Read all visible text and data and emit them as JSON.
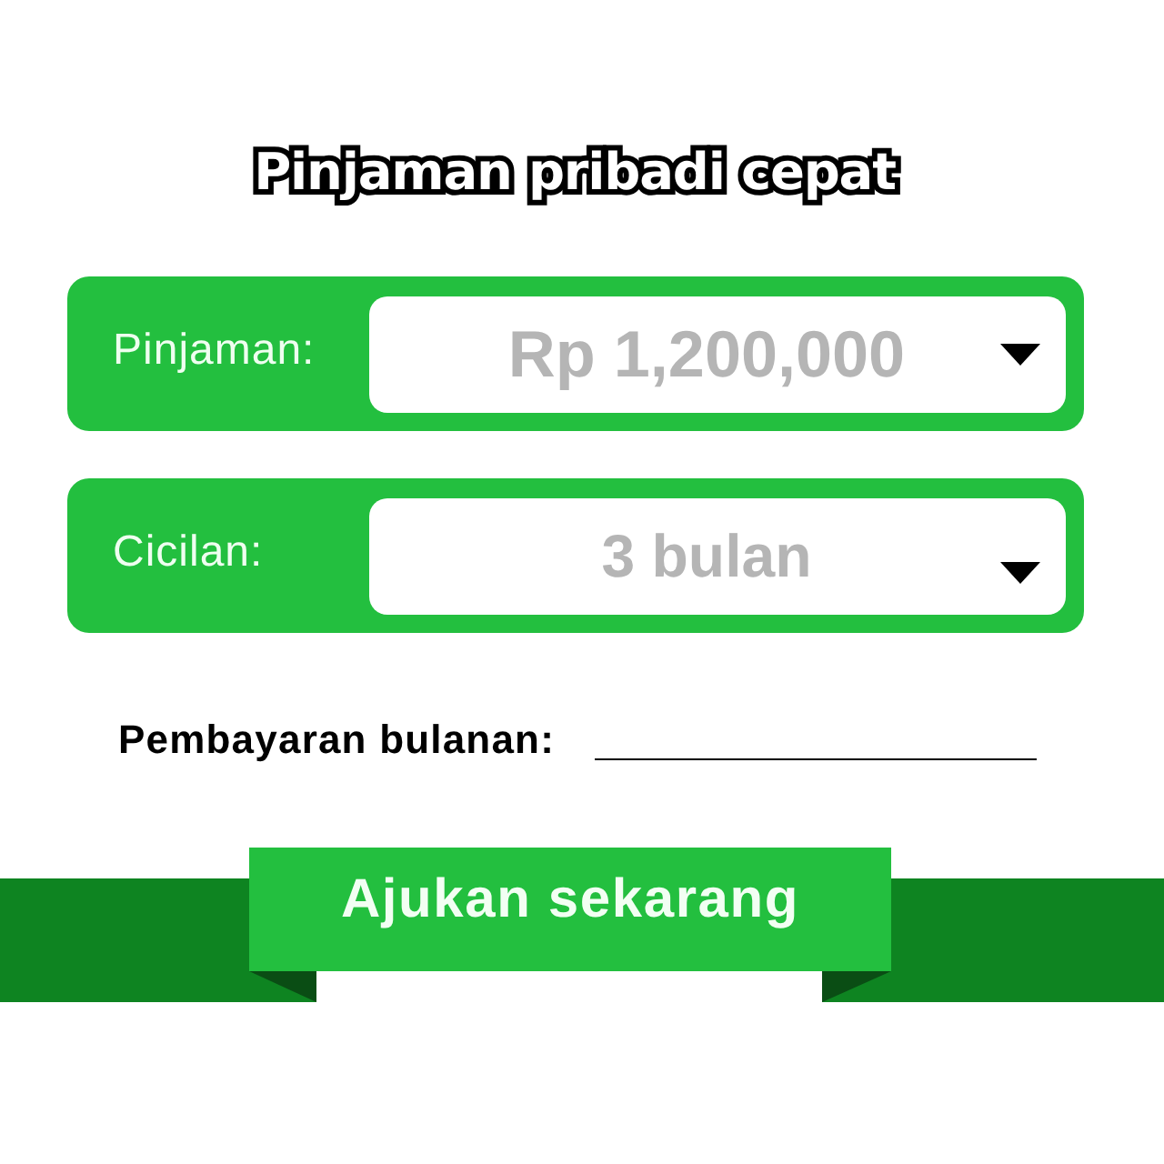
{
  "title": "Pinjaman pribadi cepat",
  "fields": [
    {
      "label": "Pinjaman:",
      "value": "Rp 1,200,000"
    },
    {
      "label": "Cicilan:",
      "value": "3 bulan"
    }
  ],
  "monthly_payment": {
    "label": "Pembayaran bulanan:"
  },
  "submit_button": {
    "label": "Ajukan sekarang"
  }
}
